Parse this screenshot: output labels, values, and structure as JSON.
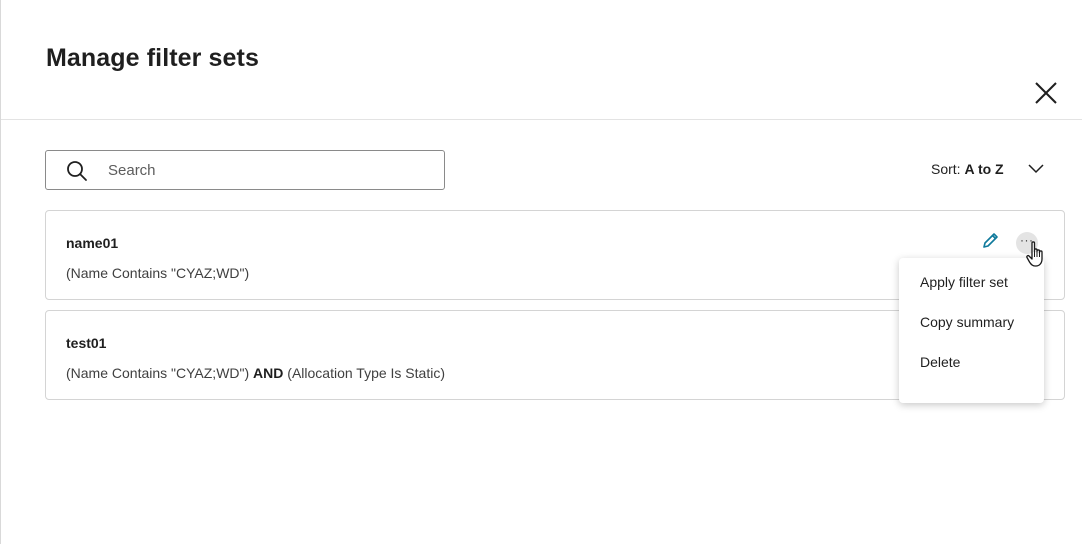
{
  "dialog": {
    "title": "Manage filter sets",
    "close_icon": "close-icon"
  },
  "search": {
    "placeholder": "Search",
    "value": "",
    "icon": "search-icon"
  },
  "sort": {
    "label": "Sort:",
    "value": "A to Z",
    "icon": "chevron-down-icon"
  },
  "filter_sets": [
    {
      "name": "name01",
      "summary_parts": [
        "(Name Contains \"CYAZ;WD\")"
      ]
    },
    {
      "name": "test01",
      "summary_parts": [
        "(Name Contains \"CYAZ;WD\")",
        "AND",
        "(Allocation Type Is Static)"
      ]
    }
  ],
  "row_actions": {
    "edit_icon": "pencil-icon",
    "more_icon": "more-horizontal-icon",
    "cursor_icon": "hand-pointer-icon"
  },
  "context_menu": {
    "items": [
      "Apply filter set",
      "Copy summary",
      "Delete"
    ]
  },
  "colors": {
    "accent": "#0f7a9c",
    "text": "#1f1f1f",
    "border": "#d4d4d4"
  }
}
